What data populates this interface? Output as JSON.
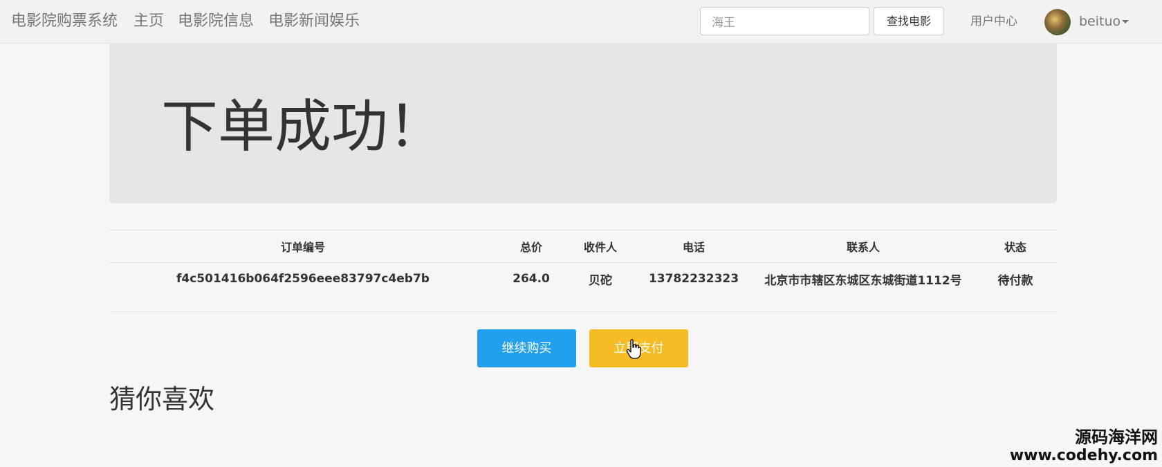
{
  "navbar": {
    "brand": "电影院购票系统",
    "links": [
      "主页",
      "电影院信息",
      "电影新闻娱乐"
    ],
    "search": {
      "value": "海王",
      "button_label": "查找电影"
    },
    "user_center": "用户中心",
    "username": "beituo"
  },
  "jumbotron": {
    "title": "下单成功！"
  },
  "order_table": {
    "headers": [
      "订单编号",
      "总价",
      "收件人",
      "电话",
      "联系人",
      "状态"
    ],
    "row": [
      "f4c501416b064f2596eee83797c4eb7b",
      "264.0",
      "贝砣",
      "13782232323",
      "北京市市辖区东城区东城街道1112号",
      "待付款"
    ]
  },
  "actions": {
    "continue_label": "继续购买",
    "pay_label": "立即支付"
  },
  "recommend": {
    "title": "猜你喜欢"
  },
  "watermark": {
    "line1": "源码海洋网",
    "line2": "www.codehy.com"
  },
  "colors": {
    "continue_button": "#22a0f0",
    "pay_button": "#f5bc25",
    "jumbotron": "#e6e6e6"
  },
  "icons": [
    "hand-pointer-cursor-icon",
    "dropdown-caret-icon"
  ]
}
